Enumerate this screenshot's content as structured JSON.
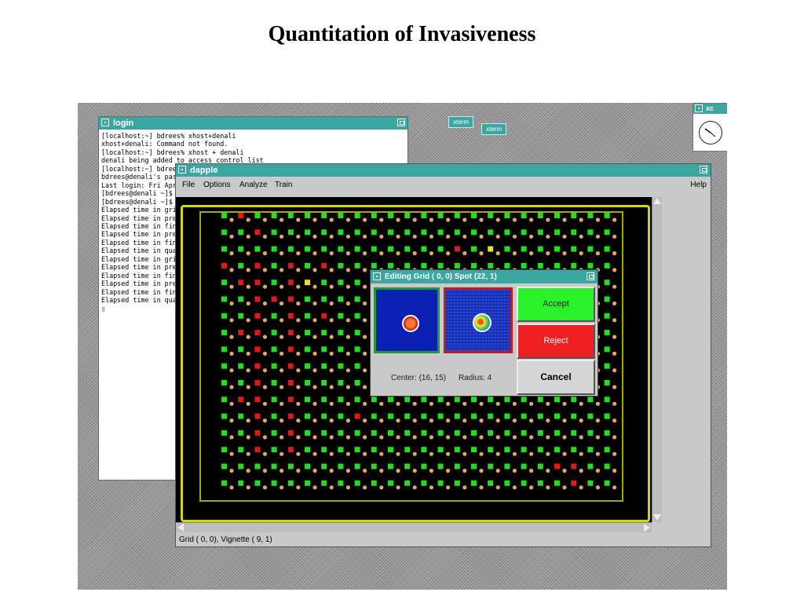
{
  "slide": {
    "title": "Quantitation of Invasiveness"
  },
  "login_window": {
    "title": "login",
    "terminal_lines": [
      "[localhost:~] bdrees% xhost+denali",
      "xhost+denali: Command not found.",
      "[localhost:~] bdrees% xhost + denali",
      "denali being added to access control list",
      "[localhost:~] bdrees",
      "bdrees@denali's pass",
      "Last login: Fri Apr",
      "[bdrees@denali ~]$ s",
      "[bdrees@denali ~]$ d",
      "Elapsed time in grid",
      "Elapsed time in pref",
      "Elapsed time in find",
      "Elapsed time in pref",
      "Elapsed time in find",
      "Elapsed time in quan",
      "Elapsed time in grid",
      "Elapsed time in pref",
      "Elapsed time in find",
      "Elapsed time in pref",
      "Elapsed time in find",
      "Elapsed time in quan",
      "▯"
    ]
  },
  "icons": {
    "xterm1": "xterm",
    "xterm2": "xterm",
    "xclock_title": "xc"
  },
  "dapple": {
    "title": "dapple",
    "menu": {
      "file": "File",
      "options": "Options",
      "analyze": "Analyze",
      "train": "Train",
      "help": "Help"
    },
    "status": "Grid ( 0,  0), Vignette ( 9,  1)"
  },
  "dialog": {
    "title": "Editing Grid ( 0,  0) Spot (22,  1)",
    "center": "Center: (16, 15)",
    "radius": "Radius:  4",
    "accept": "Accept",
    "reject": "Reject",
    "cancel": "Cancel"
  },
  "colors": {
    "titlebar": "#3aa7a0",
    "accept": "#2af22a",
    "reject": "#ee2020",
    "plate": "#d6d600"
  }
}
